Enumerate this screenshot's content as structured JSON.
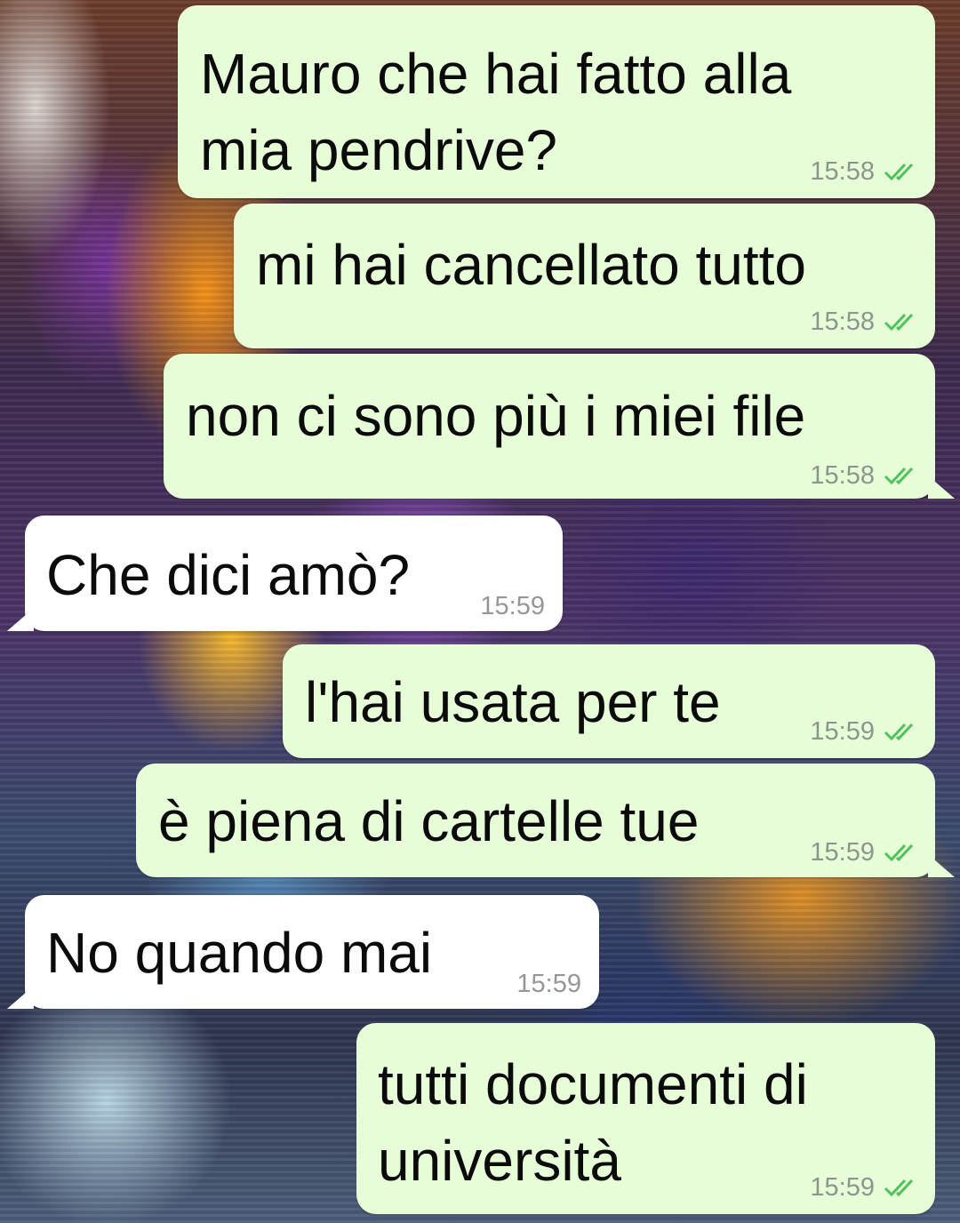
{
  "colors": {
    "outgoing_bubble": "#e7fdd8",
    "incoming_bubble": "#ffffff",
    "read_ticks": "#4fc35a",
    "timestamp": "#8c968c"
  },
  "messages": [
    {
      "direction": "outgoing",
      "text_lines": [
        "Mauro che hai fatto alla",
        "mia pendrive?"
      ],
      "time": "15:58",
      "status": "read-ticks-icon"
    },
    {
      "direction": "outgoing",
      "text_lines": [
        "mi hai cancellato tutto"
      ],
      "time": "15:58",
      "status": "read-ticks-icon"
    },
    {
      "direction": "outgoing",
      "text_lines": [
        "non ci sono più i miei file"
      ],
      "time": "15:58",
      "status": "read-ticks-icon"
    },
    {
      "direction": "incoming",
      "text_lines": [
        "Che dici amò?"
      ],
      "time": "15:59"
    },
    {
      "direction": "outgoing",
      "text_lines": [
        "l'hai usata per te"
      ],
      "time": "15:59",
      "status": "read-ticks-icon"
    },
    {
      "direction": "outgoing",
      "text_lines": [
        "è piena di cartelle tue"
      ],
      "time": "15:59",
      "status": "read-ticks-icon"
    },
    {
      "direction": "incoming",
      "text_lines": [
        "No quando mai"
      ],
      "time": "15:59"
    },
    {
      "direction": "outgoing",
      "text_lines": [
        "tutti documenti di",
        "università"
      ],
      "time": "15:59",
      "status": "read-ticks-icon"
    }
  ]
}
